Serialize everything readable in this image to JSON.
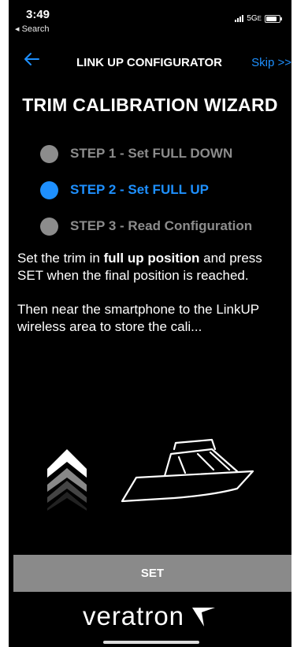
{
  "status_bar": {
    "time": "3:49",
    "back_app": "◂ Search",
    "network": "5G",
    "network_suffix": "E"
  },
  "nav": {
    "title": "LINK UP CONFIGURATOR",
    "skip": "Skip >>"
  },
  "wizard": {
    "title": "TRIM CALIBRATION WIZARD",
    "steps": [
      {
        "label": "STEP 1 - Set FULL DOWN",
        "active": false
      },
      {
        "label": "STEP 2 - Set FULL UP",
        "active": true
      },
      {
        "label": "STEP 3 - Read Configuration",
        "active": false
      }
    ]
  },
  "instructions": {
    "line1_before": "Set the trim in ",
    "line1_bold": "full up position",
    "line1_after": " and press SET when the final position is reached.",
    "line2": "Then near the smartphone to the LinkUP wireless area to store the cali..."
  },
  "actions": {
    "set_label": "SET"
  },
  "brand": {
    "name": "veratron"
  },
  "colors": {
    "accent": "#1e90ff",
    "inactive": "#8c8c8c",
    "background": "#000000"
  },
  "icons": [
    "back-arrow-icon",
    "trim-up-arrows-icon",
    "boat-icon",
    "veratron-logo-icon"
  ]
}
